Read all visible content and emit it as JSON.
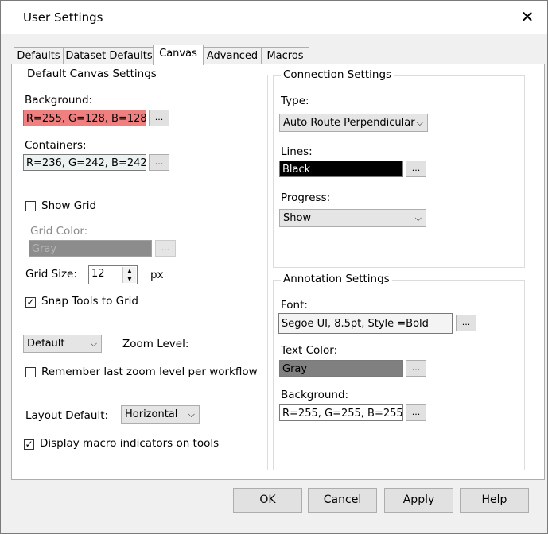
{
  "window": {
    "title": "User Settings",
    "close_glyph": "✕"
  },
  "tabs": [
    {
      "label": "Defaults"
    },
    {
      "label": "Dataset Defaults"
    },
    {
      "label": "Canvas"
    },
    {
      "label": "Advanced"
    },
    {
      "label": "Macros"
    }
  ],
  "active_tab": "Canvas",
  "canvas_settings": {
    "legend": "Default Canvas Settings",
    "background_label": "Background:",
    "background_value": "R=255, G=128, B=128",
    "background_color": "#f08080",
    "containers_label": "Containers:",
    "containers_value": "R=236, G=242, B=242",
    "containers_color": "#ecf2f2",
    "show_grid_label": "Show Grid",
    "show_grid_checked": false,
    "grid_color_label": "Grid Color:",
    "grid_color_value": "Gray",
    "grid_size_label": "Grid Size:",
    "grid_size_value": "12",
    "grid_size_unit": "px",
    "snap_label": "Snap Tools to Grid",
    "snap_checked": true,
    "zoom_select": "Default",
    "zoom_label": "Zoom Level:",
    "remember_zoom_label": "Remember last zoom level per workflow",
    "remember_zoom_checked": false,
    "layout_label": "Layout Default:",
    "layout_value": "Horizontal",
    "macro_indicators_label": "Display macro indicators on tools",
    "macro_indicators_checked": true,
    "browse_label": "..."
  },
  "connection_settings": {
    "legend": "Connection Settings",
    "type_label": "Type:",
    "type_value": "Auto Route Perpendicular",
    "lines_label": "Lines:",
    "lines_value": "Black",
    "progress_label": "Progress:",
    "progress_value": "Show",
    "browse_label": "..."
  },
  "annotation_settings": {
    "legend": "Annotation Settings",
    "font_label": "Font:",
    "font_value": "Segoe UI, 8.5pt, Style =Bold",
    "text_color_label": "Text Color:",
    "text_color_value": "Gray",
    "background_label": "Background:",
    "background_value": "R=255, G=255, B=255",
    "browse_label": "..."
  },
  "buttons": {
    "ok": "OK",
    "cancel": "Cancel",
    "apply": "Apply",
    "help": "Help"
  },
  "icons": {
    "dropdown": "chevron-down-icon",
    "check": "checkmark-icon"
  },
  "glyphs": {
    "chevron": "⌵",
    "check": "✓",
    "spin_up": "▲",
    "spin_down": "▼"
  }
}
